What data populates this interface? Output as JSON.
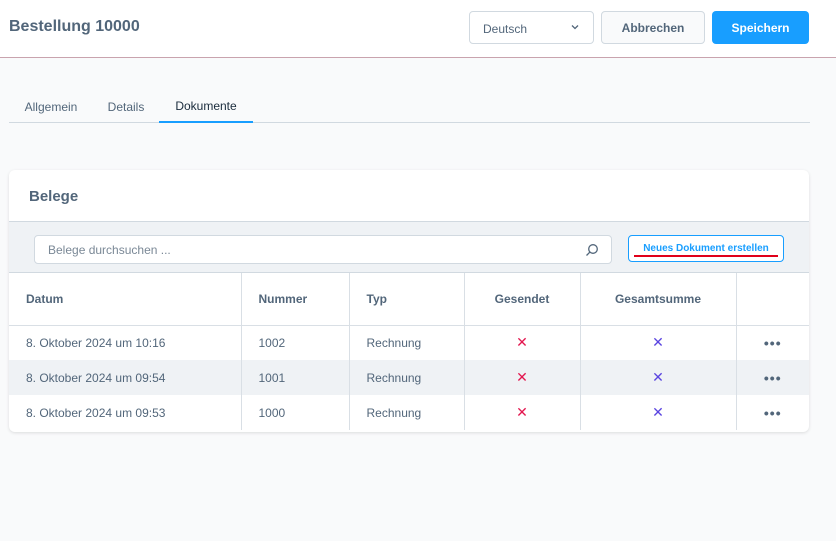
{
  "header": {
    "title": "Bestellung 10000",
    "language_value": "Deutsch",
    "cancel_label": "Abbrechen",
    "save_label": "Speichern"
  },
  "tabs": [
    {
      "label": "Allgemein",
      "active": false
    },
    {
      "label": "Details",
      "active": false
    },
    {
      "label": "Dokumente",
      "active": true
    }
  ],
  "card": {
    "title": "Belege",
    "search_placeholder": "Belege durchsuchen ...",
    "new_document_label": "Neues Dokument erstellen"
  },
  "table": {
    "columns": [
      "Datum",
      "Nummer",
      "Typ",
      "Gesendet",
      "Gesamtsumme",
      ""
    ],
    "rows": [
      {
        "datum": "8. Oktober 2024 um 10:16",
        "nummer": "1002",
        "typ": "Rechnung",
        "gesendet": "✕",
        "gesamtsumme": "✕",
        "actions": "•••"
      },
      {
        "datum": "8. Oktober 2024 um 09:54",
        "nummer": "1001",
        "typ": "Rechnung",
        "gesendet": "✕",
        "gesamtsumme": "✕",
        "actions": "•••"
      },
      {
        "datum": "8. Oktober 2024 um 09:53",
        "nummer": "1000",
        "typ": "Rechnung",
        "gesendet": "✕",
        "gesamtsumme": "✕",
        "actions": "•••"
      }
    ]
  },
  "colors": {
    "accent": "#189eff",
    "cross_red": "#e3174f",
    "cross_purple": "#5a44e0"
  }
}
